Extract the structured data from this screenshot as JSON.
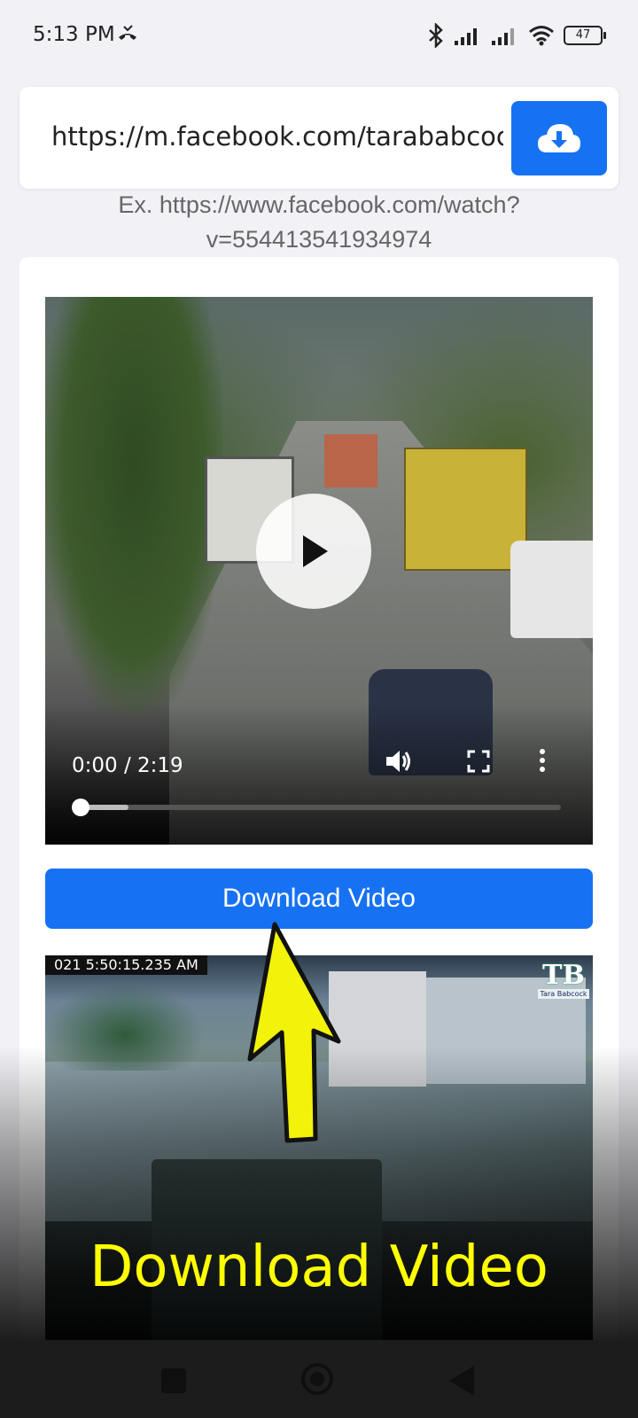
{
  "status_bar": {
    "time": "5:13 PM",
    "battery": "47",
    "icons": [
      "missed-call-icon",
      "bluetooth-icon",
      "signal-icon",
      "signal-icon",
      "wifi-icon",
      "battery-icon"
    ]
  },
  "url_bar": {
    "value": "https://m.facebook.com/tarababcock",
    "download_icon": "cloud-download-icon"
  },
  "hint": {
    "line1": "Ex. https://www.facebook.com/watch?",
    "line2": "v=554413541934974"
  },
  "video_player": {
    "time": "0:00 / 2:19",
    "progress_fraction": 0.1,
    "controls": [
      "play-icon",
      "volume-icon",
      "fullscreen-icon",
      "more-icon"
    ]
  },
  "download_button": {
    "label": "Download Video"
  },
  "thumbnail": {
    "timestamp": "021 5:50:15.235 AM",
    "logo_text": "TB",
    "logo_subtext": "Tara Babcock"
  },
  "overlay": {
    "caption": "Download Video"
  },
  "colors": {
    "accent": "#1772f3",
    "caption": "#ffff00"
  }
}
